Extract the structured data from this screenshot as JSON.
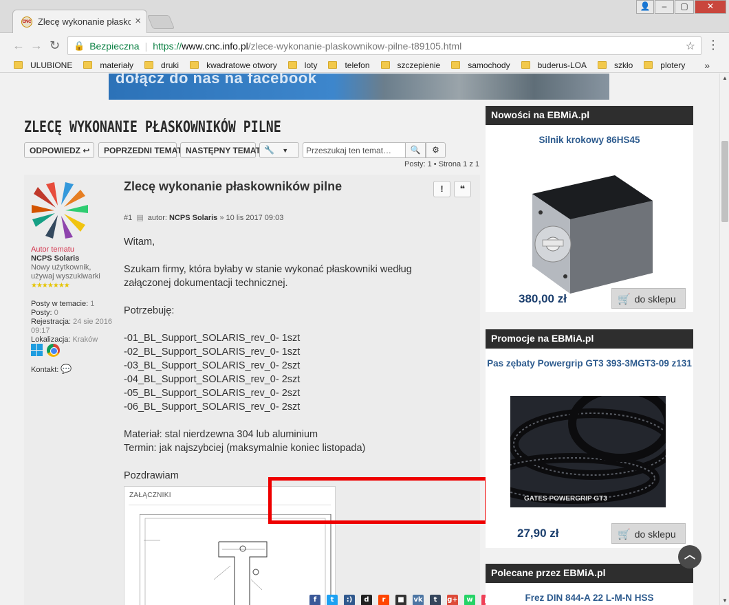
{
  "browser": {
    "tab_title": "Zlecę wykonanie płaskow",
    "favicon_text": "CNC",
    "secure_label": "Bezpieczna",
    "url_scheme": "https://",
    "url_host": "www.cnc.info.pl",
    "url_path": "/zlece-wykonanie-plaskownikow-pilne-t89105.html",
    "bookmarks": [
      "ULUBIONE",
      "materiały",
      "druki",
      "kwadratowe otwory",
      "loty",
      "telefon",
      "szczepienie",
      "samochody",
      "buderus-LOA",
      "szkło",
      "plotery"
    ]
  },
  "banner": {
    "text": "dołącz do nas na facebook"
  },
  "topic": {
    "title": "ZLECĘ WYKONANIE PŁASKOWNIKÓW PILNE",
    "buttons": {
      "reply": "ODPOWIEDZ",
      "prev": "POPRZEDNI TEMAT",
      "next": "NASTĘPNY TEMAT"
    },
    "search_placeholder": "Przeszukaj ten temat…",
    "pagination": "Posty: 1 • Strona 1 z 1"
  },
  "post": {
    "title": "Zlecę wykonanie płaskowników pilne",
    "number": "#1",
    "meta_prefix": "autor:",
    "author": "NCPS Solaris",
    "date": "» 10 lis 2017 09:03",
    "body": [
      "Witam,",
      "",
      "Szukam firmy, która byłaby w stanie wykonać płaskowniki według",
      "załączonej dokumentacji technicznej.",
      "",
      "Potrzebuję:",
      "",
      "-01_BL_Support_SOLARIS_rev_0- 1szt",
      "-02_BL_Support_SOLARIS_rev_0- 1szt",
      "-03_BL_Support_SOLARIS_rev_0- 2szt",
      "-04_BL_Support_SOLARIS_rev_0- 2szt",
      "-05_BL_Support_SOLARIS_rev_0- 2szt",
      "-06_BL_Support_SOLARIS_rev_0- 2szt",
      "",
      "Materiał: stal nierdzewna 304 lub aluminium",
      "Termin: jak najszybciej (maksymalnie koniec listopada)",
      "",
      "Pozdrawiam"
    ],
    "attachments_label": "ZAŁĄCZNIKI"
  },
  "author_profile": {
    "role": "Autor tematu",
    "name": "NCPS Solaris",
    "rank": "Nowy użytkownik, używaj wyszukiwarki",
    "stars": "★★★★★★★",
    "stats": [
      {
        "k": "Posty w temacie:",
        "v": "1"
      },
      {
        "k": "Posty:",
        "v": "0"
      },
      {
        "k": "Rejestracja:",
        "v": "24 sie 2016 09:17"
      },
      {
        "k": "Lokalizacja:",
        "v": "Kraków"
      }
    ],
    "contact_label": "Kontakt:"
  },
  "share_icons": [
    "facebook",
    "twitter",
    "myspace",
    "digg",
    "reddit",
    "delicious",
    "vk",
    "tumblr",
    "google-plus",
    "whatsapp",
    "pocket"
  ],
  "sidebar": {
    "new_header": "Nowości na EBMiA.pl",
    "new_product": "Silnik krokowy 86HS45",
    "new_price": "380,00 zł",
    "promo_header": "Promocje na EBMiA.pl",
    "promo_product": "Pas zębaty Powergrip GT3 393-3MGT3-09 z131",
    "promo_price": "27,90 zł",
    "rec_header": "Polecane przez EBMiA.pl",
    "rec_product": "Frez DIN 844-A 22 L-M-N HSS",
    "cart_label": "do sklepu",
    "belt_text": "GATES POWERGRIP GT3"
  },
  "colors": {
    "highlight": "#ee0000",
    "link": "#2d5b8e",
    "price": "#1c3f6e",
    "header_bg": "#2e2e2e"
  }
}
